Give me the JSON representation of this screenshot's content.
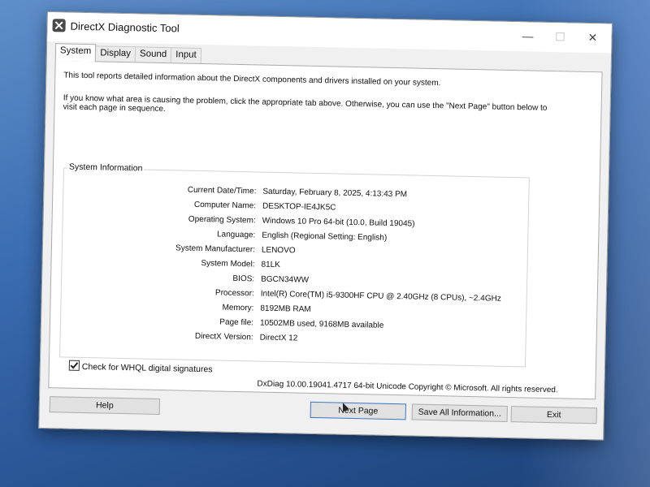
{
  "window": {
    "title": "DirectX Diagnostic Tool",
    "minimize_icon": "minimize-icon",
    "maximize_icon": "maximize-icon",
    "close_icon": "close-icon"
  },
  "tabs": [
    {
      "label": "System",
      "active": true
    },
    {
      "label": "Display",
      "active": false
    },
    {
      "label": "Sound",
      "active": false
    },
    {
      "label": "Input",
      "active": false
    }
  ],
  "intro": {
    "line1": "This tool reports detailed information about the DirectX components and drivers installed on your system.",
    "line2": "If you know what area is causing the problem, click the appropriate tab above.  Otherwise, you can use the \"Next Page\" button below to",
    "line3": "visit each page in sequence."
  },
  "system_info": {
    "title": "System Information",
    "rows": [
      {
        "label": "Current Date/Time:",
        "value": "Saturday, February 8, 2025, 4:13:43 PM"
      },
      {
        "label": "Computer Name:",
        "value": "DESKTOP-IE4JK5C"
      },
      {
        "label": "Operating System:",
        "value": "Windows 10 Pro 64-bit (10.0, Build 19045)"
      },
      {
        "label": "Language:",
        "value": "English (Regional Setting: English)"
      },
      {
        "label": "System Manufacturer:",
        "value": "LENOVO"
      },
      {
        "label": "System Model:",
        "value": "81LK"
      },
      {
        "label": "BIOS:",
        "value": "BGCN34WW"
      },
      {
        "label": "Processor:",
        "value": "Intel(R) Core(TM) i5-9300HF CPU @ 2.40GHz (8 CPUs), ~2.4GHz"
      },
      {
        "label": "Memory:",
        "value": "8192MB RAM"
      },
      {
        "label": "Page file:",
        "value": "10502MB used, 9168MB available"
      },
      {
        "label": "DirectX Version:",
        "value": "DirectX 12"
      }
    ]
  },
  "whql": {
    "label": "Check for WHQL digital signatures",
    "checked": true
  },
  "version_text": "DxDiag 10.00.19041.4717 64-bit Unicode  Copyright © Microsoft. All rights reserved.",
  "buttons": {
    "help": "Help",
    "next_page": "Next Page",
    "save_all": "Save All Information...",
    "exit": "Exit"
  }
}
